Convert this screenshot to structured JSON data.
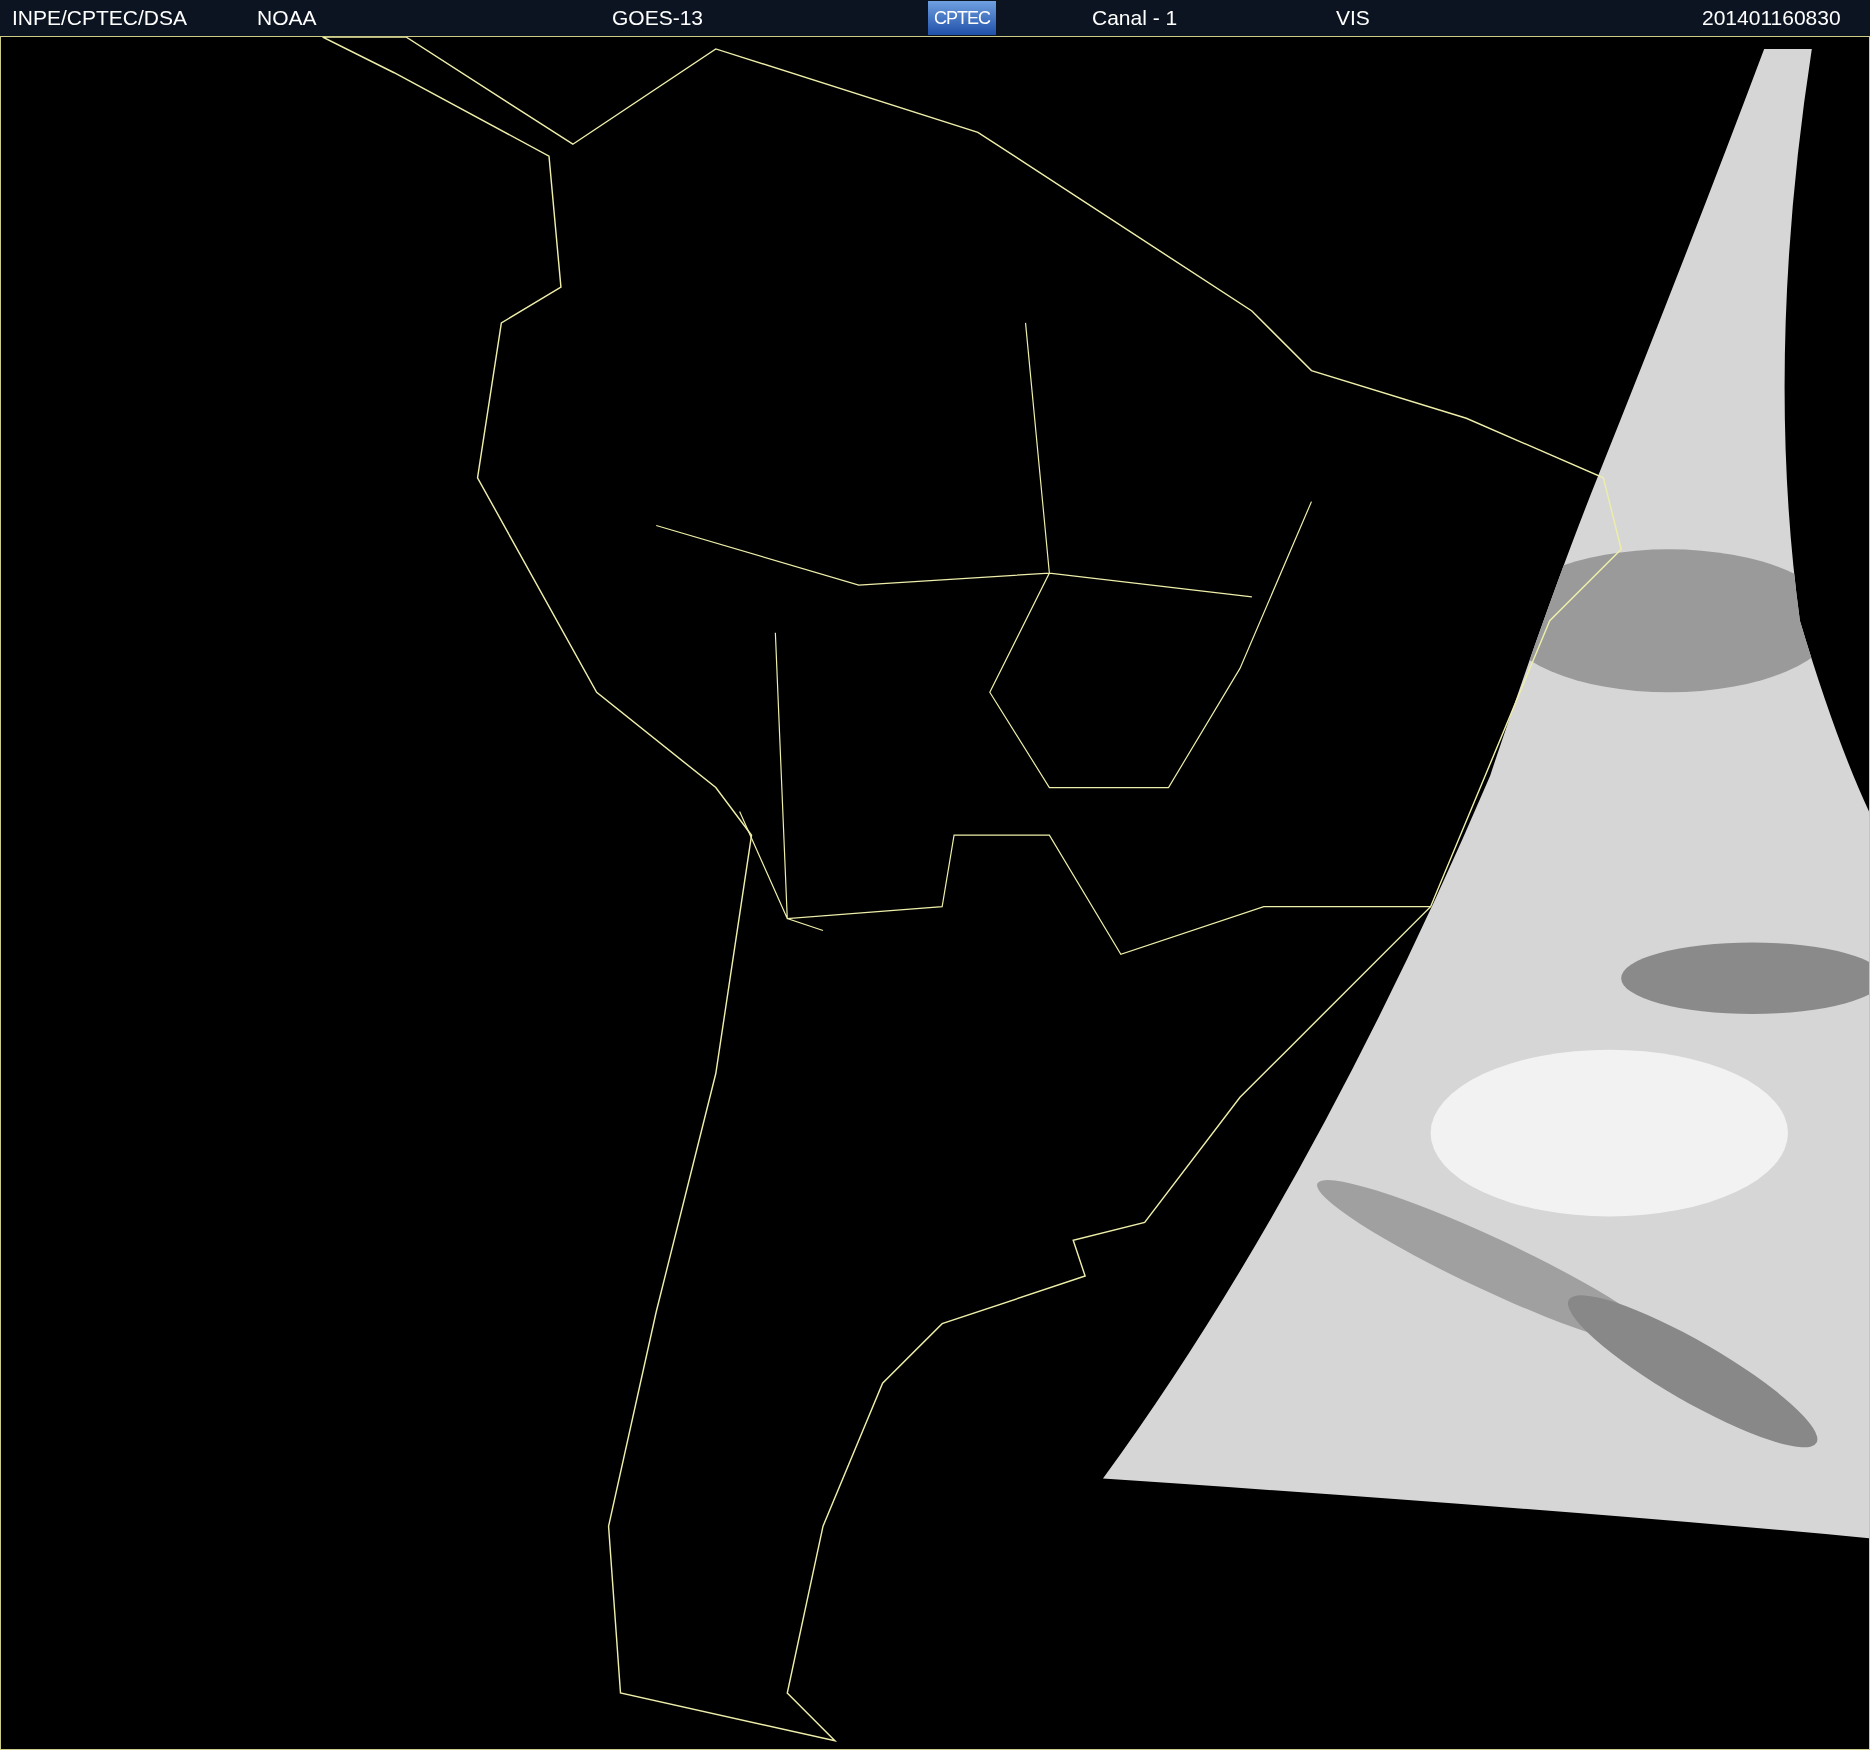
{
  "header": [
    {
      "kind": "text",
      "text": "INPE/CPTEC/DSA"
    },
    {
      "kind": "text",
      "text": "NOAA"
    },
    {
      "kind": "text",
      "text": "GOES-13"
    },
    {
      "kind": "logo",
      "text": "CPTEC"
    },
    {
      "kind": "text",
      "text": "Canal - 1"
    },
    {
      "kind": "text",
      "text": "VIS"
    },
    {
      "kind": "text",
      "text": "201401160830"
    }
  ]
}
